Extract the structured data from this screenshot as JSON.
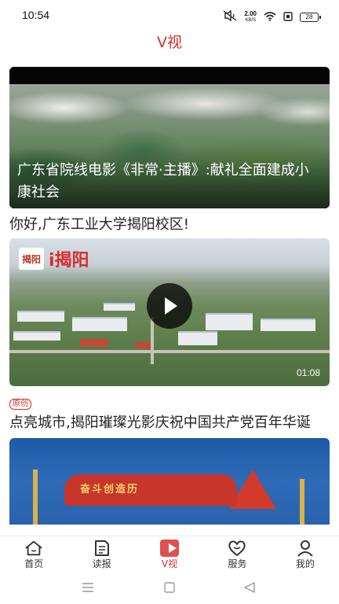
{
  "status": {
    "time": "10:54",
    "net_speed": "2.00",
    "net_unit": "KB/S",
    "battery": "28"
  },
  "header": {
    "title": "V视"
  },
  "feed": [
    {
      "caption": "广东省院线电影《非常·主播》:献礼全面建成小康社会"
    },
    {
      "title": "你好,广东工业大学揭阳校区!",
      "logo_text": "i揭阳",
      "logo_mark": "揭阳",
      "duration": "01:08",
      "badge": "原创"
    },
    {
      "title": "点亮城市,揭阳璀璨光影庆祝中国共产党百年华诞",
      "banner_text": "奋斗创造历"
    }
  ],
  "bottom_nav": [
    {
      "label": "首页",
      "icon": "home-icon"
    },
    {
      "label": "读报",
      "icon": "newspaper-icon"
    },
    {
      "label": "V视",
      "icon": "video-icon",
      "active": true
    },
    {
      "label": "服务",
      "icon": "heart-service-icon"
    },
    {
      "label": "我的",
      "icon": "user-icon"
    }
  ],
  "colors": {
    "accent": "#d62e2e"
  }
}
